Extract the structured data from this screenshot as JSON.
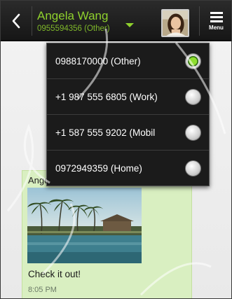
{
  "header": {
    "contact_name": "Angela Wang",
    "contact_number": "0955594356 (Other)",
    "menu_label": "Menu"
  },
  "phone_menu": {
    "items": [
      {
        "label": "0988170000 (Other)",
        "selected": true
      },
      {
        "label": "+1 987 555 6805 (Work)",
        "selected": false
      },
      {
        "label": "+1 587 555 9202 (Mobil",
        "selected": false
      },
      {
        "label": "0972949359 (Home)",
        "selected": false
      }
    ]
  },
  "message": {
    "sender": "Angela Wang",
    "sender_address": "(                    )",
    "text": "Check it out!",
    "time": "8:05 PM"
  },
  "colors": {
    "accent_green": "#8fd12d",
    "bubble_green": "#d9efc1",
    "bar_dark": "#1b1b1b"
  }
}
